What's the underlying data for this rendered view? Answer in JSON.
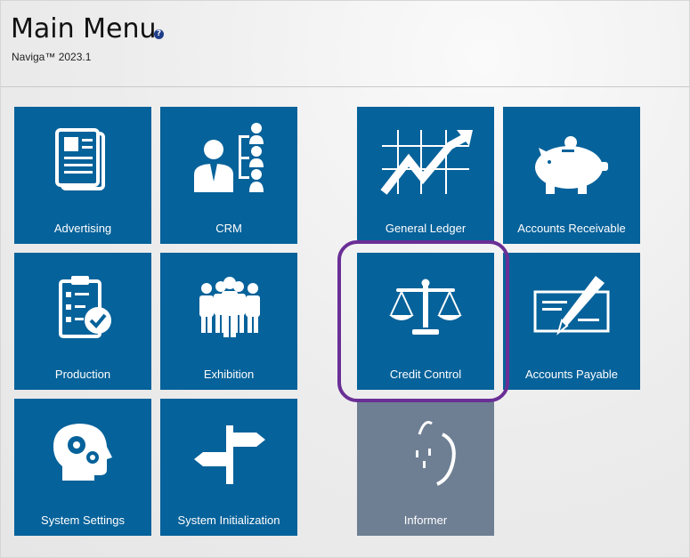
{
  "header": {
    "title": "Main Menu",
    "help_icon": "question-circle-icon",
    "version": "Naviga™ 2023.1"
  },
  "tiles": {
    "advertising": {
      "label": "Advertising",
      "icon": "newspaper-icon"
    },
    "crm": {
      "label": "CRM",
      "icon": "org-chart-icon"
    },
    "general_ledger": {
      "label": "General Ledger",
      "icon": "chart-grid-icon"
    },
    "accounts_receivable": {
      "label": "Accounts Receivable",
      "icon": "piggy-bank-icon"
    },
    "production": {
      "label": "Production",
      "icon": "clipboard-check-icon"
    },
    "exhibition": {
      "label": "Exhibition",
      "icon": "people-group-icon"
    },
    "credit_control": {
      "label": "Credit Control",
      "icon": "scales-icon"
    },
    "accounts_payable": {
      "label": "Accounts Payable",
      "icon": "check-pen-icon"
    },
    "system_settings": {
      "label": "System Settings",
      "icon": "head-gears-icon"
    },
    "system_initialization": {
      "label": "System Initialization",
      "icon": "signpost-icon"
    },
    "informer": {
      "label": "Informer",
      "icon": "apple-icon"
    }
  },
  "colors": {
    "tile": "#06629a",
    "tile_disabled": "#6e7f93",
    "highlight": "#6a2f96"
  }
}
